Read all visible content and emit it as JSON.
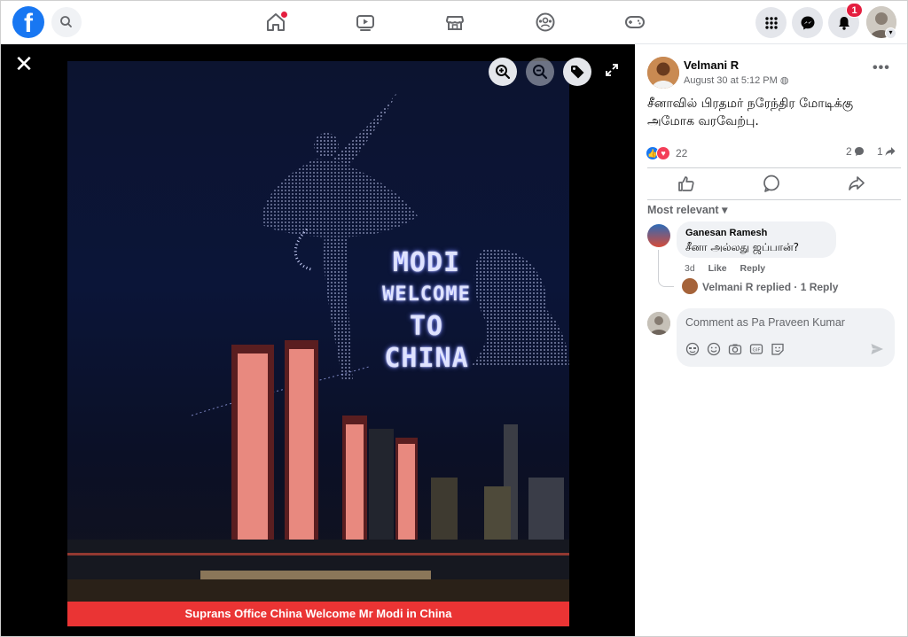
{
  "topbar": {
    "logo": "f",
    "icons": [
      "facebook-logo",
      "search-icon",
      "home-icon",
      "watch-icon",
      "marketplace-icon",
      "groups-icon",
      "gaming-icon",
      "menu-grid-icon",
      "messenger-icon",
      "notifications-icon"
    ],
    "notifications_count": "1"
  },
  "viewer": {
    "close_label": "✕",
    "photo_overlay_text": [
      "MODI",
      "WELCOME",
      "TO",
      "CHINA"
    ],
    "photo_caption": "Suprans Office China Welcome Mr Modi in China"
  },
  "post": {
    "author": "Velmani R",
    "timestamp": "August 30 at 5:12 PM",
    "more_label": "•••",
    "text_line1": "சீனாவில் பிரதமர் நரேந்திர மோடிக்கு",
    "text_line2": "அமோக வரவேற்பு.",
    "reactions_count": "22",
    "comments_count": "2",
    "shares_count": "1"
  },
  "comments": {
    "sort_label": "Most relevant",
    "items": [
      {
        "author": "Ganesan Ramesh",
        "text": "சீனா அல்லது ஜப்பான்?",
        "age": "3d",
        "like_label": "Like",
        "reply_label": "Reply"
      }
    ],
    "reply_summary": "Velmani R replied · 1 Reply",
    "input_placeholder": "Comment as Pa Praveen Kumar"
  },
  "colors": {
    "brand": "#1877f2",
    "notification": "#e41e3f",
    "caption_bar": "#ea3434"
  }
}
